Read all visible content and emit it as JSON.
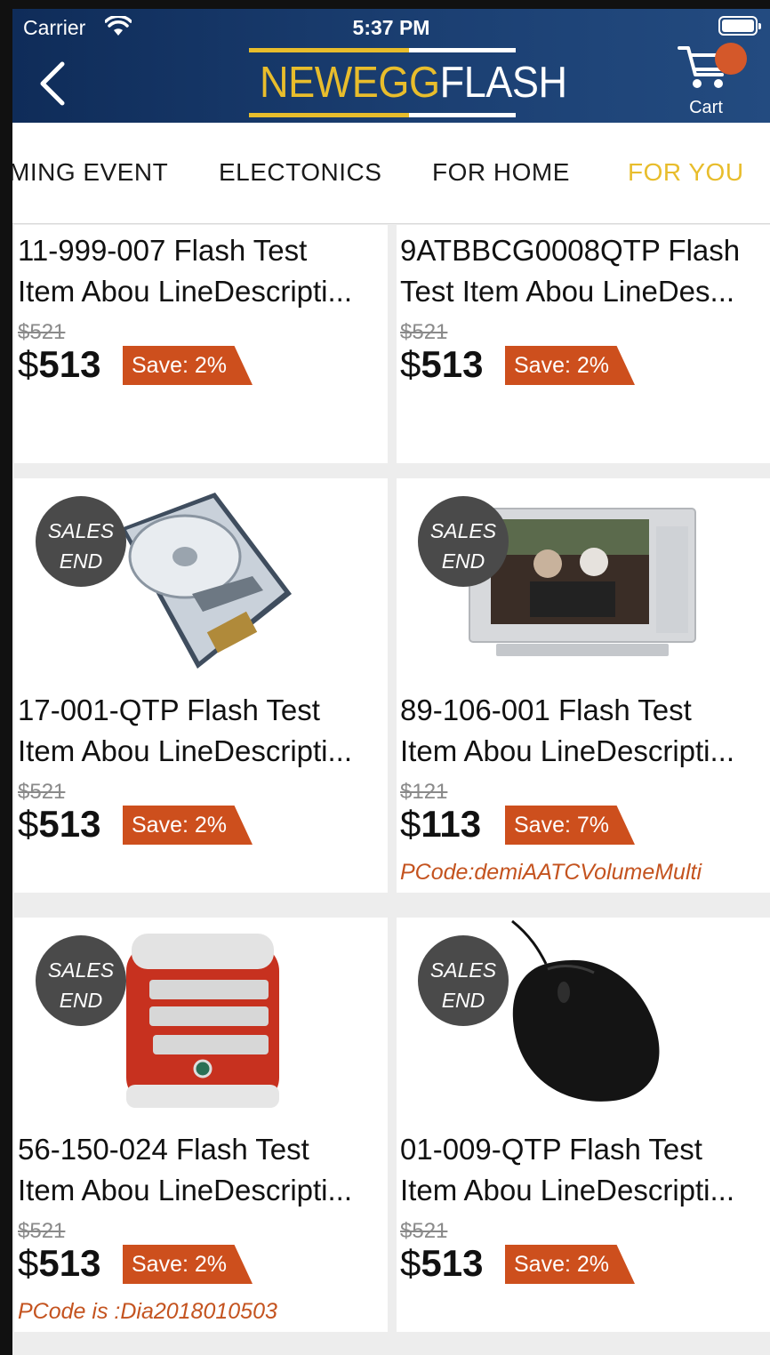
{
  "status_bar": {
    "carrier": "Carrier",
    "time": "5:37 PM"
  },
  "header": {
    "logo_part1": "NEWEGG",
    "logo_part2": "FLASH",
    "cart_label": "Cart"
  },
  "tabs": [
    {
      "label": "MING EVENT",
      "active": false
    },
    {
      "label": "ELECTONICS",
      "active": false
    },
    {
      "label": "FOR HOME",
      "active": false
    },
    {
      "label": "FOR YOU",
      "active": true
    }
  ],
  "products": [
    {
      "title_line1": "11-999-007 Flash Test",
      "title_line2": "Item Abou LineDescripti...",
      "old_price": "$521",
      "currency": "$",
      "price": "513",
      "save": "Save: 2%",
      "badge": false,
      "pcode": ""
    },
    {
      "title_line1": "9ATBBCG0008QTP Flash",
      "title_line2": "Test Item Abou LineDes...",
      "old_price": "$521",
      "currency": "$",
      "price": "513",
      "save": "Save: 2%",
      "badge": false,
      "pcode": ""
    },
    {
      "title_line1": "17-001-QTP Flash Test",
      "title_line2": "Item Abou LineDescripti...",
      "old_price": "$521",
      "currency": "$",
      "price": "513",
      "save": "Save: 2%",
      "badge": true,
      "pcode": ""
    },
    {
      "title_line1": "89-106-001 Flash Test",
      "title_line2": "Item Abou LineDescripti...",
      "old_price": "$121",
      "currency": "$",
      "price": "113",
      "save": "Save: 7%",
      "badge": true,
      "pcode": "PCode:demiAATCVolumeMulti"
    },
    {
      "title_line1": "56-150-024 Flash Test",
      "title_line2": "Item Abou LineDescripti...",
      "old_price": "$521",
      "currency": "$",
      "price": "513",
      "save": "Save: 2%",
      "badge": true,
      "pcode": "PCode is :Dia2018010503"
    },
    {
      "title_line1": "01-009-QTP Flash Test",
      "title_line2": "Item Abou LineDescripti...",
      "old_price": "$521",
      "currency": "$",
      "price": "513",
      "save": "Save: 2%",
      "badge": true,
      "pcode": ""
    }
  ],
  "badge_text": {
    "line1": "SALES",
    "line2": "END"
  },
  "colors": {
    "navy": "#0f2c59",
    "gold": "#e8bd2c",
    "orange": "#cd4f1d",
    "badge_gray": "#4a4a4a"
  }
}
